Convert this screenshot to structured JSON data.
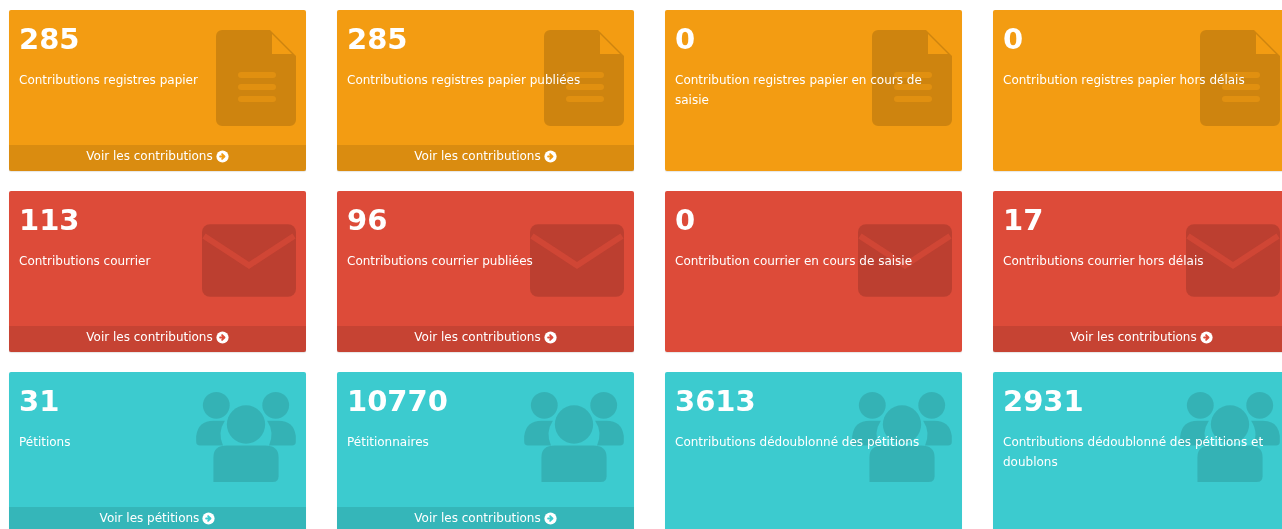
{
  "cards": [
    {
      "kind": "paper",
      "value": "285",
      "label": "Contributions registres papier",
      "link": "Voir les contributions"
    },
    {
      "kind": "paper",
      "value": "285",
      "label": "Contributions registres papier publiées",
      "link": "Voir les contributions"
    },
    {
      "kind": "paper",
      "value": "0",
      "label": "Contribution registres papier en cours de saisie"
    },
    {
      "kind": "paper",
      "value": "0",
      "label": "Contribution registres papier hors délais"
    },
    {
      "kind": "mail",
      "value": "113",
      "label": "Contributions courrier",
      "link": "Voir les contributions"
    },
    {
      "kind": "mail",
      "value": "96",
      "label": "Contributions courrier publiées",
      "link": "Voir les contributions"
    },
    {
      "kind": "mail",
      "value": "0",
      "label": "Contribution courrier en cours de saisie"
    },
    {
      "kind": "mail",
      "value": "17",
      "label": "Contributions courrier hors délais",
      "link": "Voir les contributions"
    },
    {
      "kind": "people",
      "value": "31",
      "label": "Pétitions",
      "link": "Voir les pétitions"
    },
    {
      "kind": "people",
      "value": "10770",
      "label": "Pétitionnaires",
      "link": "Voir les contributions"
    },
    {
      "kind": "people",
      "value": "3613",
      "label": "Contributions dédoublonné des pétitions"
    },
    {
      "kind": "people",
      "value": "2931",
      "label": "Contributions dédoublonné des pétitions et doublons"
    }
  ]
}
